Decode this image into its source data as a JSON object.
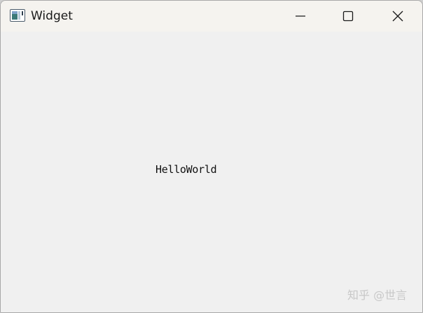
{
  "window": {
    "title": "Widget",
    "controls": {
      "minimize_icon": "minimize-icon",
      "maximize_icon": "maximize-icon",
      "close_icon": "close-icon"
    }
  },
  "content": {
    "label_text": "HelloWorld"
  },
  "watermark": {
    "text": "知乎 @世言"
  },
  "colors": {
    "titlebar_bg": "#f5f3ef",
    "client_bg": "#f0f0f0",
    "text": "#1a1a1a",
    "watermark": "#c8c8c8"
  }
}
